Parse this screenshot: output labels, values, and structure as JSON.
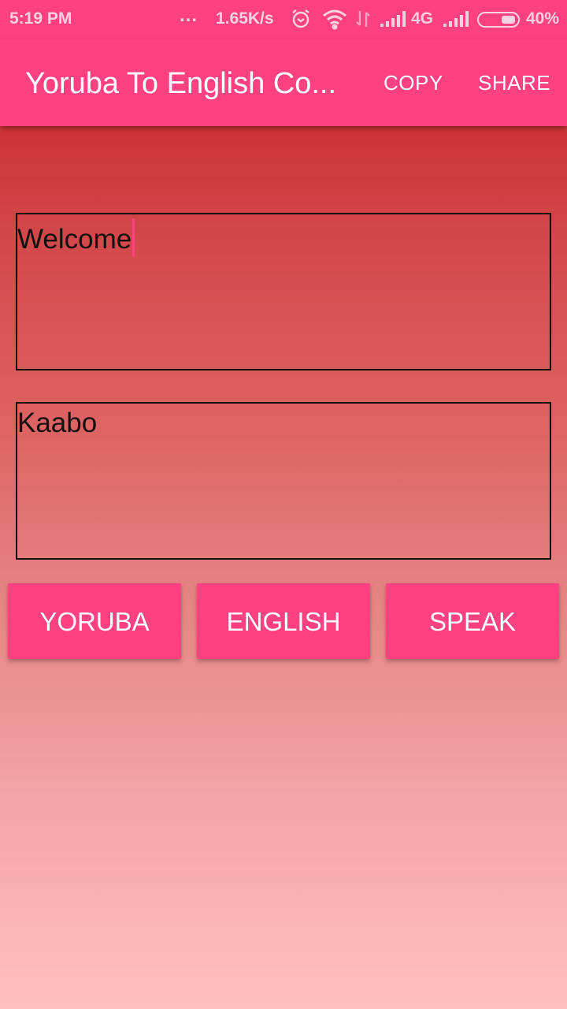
{
  "status_bar": {
    "time": "5:19 PM",
    "more_indicator": "...",
    "network_speed": "1.65K/s",
    "network_type": "4G",
    "battery_percent": "40%",
    "battery_level": 0.4,
    "icons": [
      "alarm-icon",
      "wifi-icon",
      "data-transfer-icon",
      "signal-icon",
      "signal-icon-2",
      "battery-icon"
    ]
  },
  "app_bar": {
    "title": "Yoruba To English Co...",
    "actions": [
      {
        "label": "COPY",
        "icon": "none"
      },
      {
        "label": "SHARE",
        "icon": "none"
      }
    ]
  },
  "main": {
    "input_text": "Welcome",
    "output_text": "Kaabo",
    "buttons": [
      {
        "label": "YORUBA"
      },
      {
        "label": "ENGLISH"
      },
      {
        "label": "SPEAK"
      }
    ]
  },
  "colors": {
    "accent": "#ff4081",
    "background_top": "#cc3333",
    "background_bottom": "#ffc0c0"
  }
}
